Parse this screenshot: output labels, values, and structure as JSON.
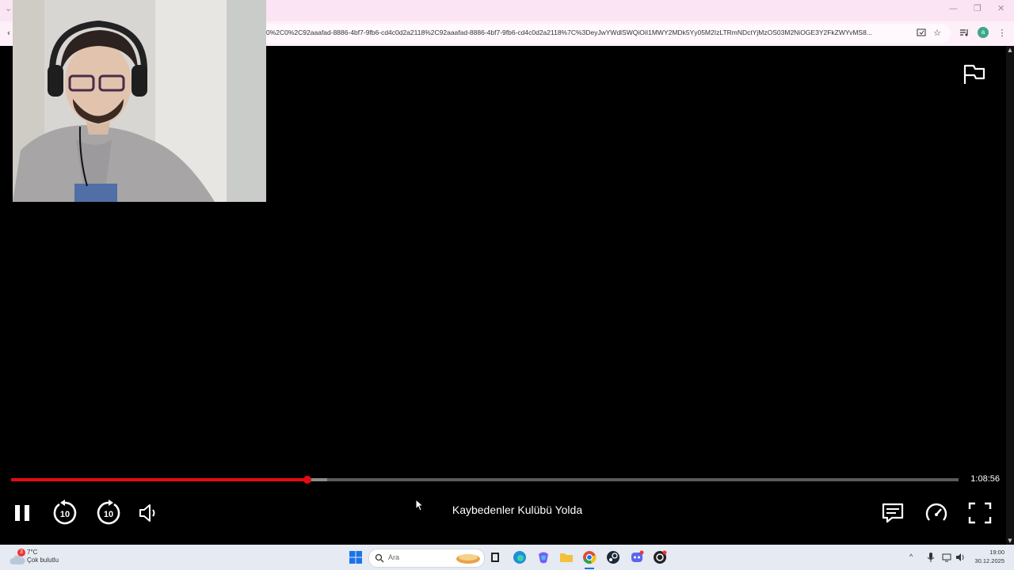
{
  "browser": {
    "url": "0%2C0%2C92aaafad-8886-4bf7-9fb6-cd4c0d2a2118%2C92aaafad-8886-4bf7-9fb6-cd4c0d2a2118%7C%3DeyJwYWdlSWQiOiI1MWY2MDk5Yy05M2IzLTRmNDctYjMzOS03M2NiOGE3Y2FkZWYvMS8...",
    "profile_initial": "a"
  },
  "player": {
    "title": "Kaybedenler Kulübü Yolda",
    "time_remaining": "1:08:56",
    "progress_fraction": 0.313,
    "buffer_fraction": 0.334,
    "skip_back_label": "10",
    "skip_forward_label": "10",
    "accent_color": "#e50914"
  },
  "taskbar": {
    "weather_temp": "7°C",
    "weather_desc": "Çok bulutlu",
    "weather_badge": "3",
    "search_placeholder": "Ara",
    "clock_time": "19:00",
    "clock_date": "30.12.2025"
  }
}
